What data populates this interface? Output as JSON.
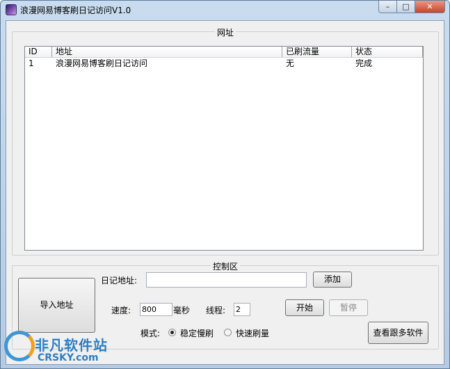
{
  "window": {
    "title": "浪漫网易博客刷日记访问V1.0",
    "controls": {
      "minimize": "–",
      "maximize": "□",
      "close": "✕"
    }
  },
  "url_group": {
    "title": "网址",
    "columns": [
      "ID",
      "地址",
      "已刷流量",
      "状态"
    ],
    "rows": [
      {
        "id": "1",
        "address": "浪漫网易博客刷日记访问",
        "traffic": "无",
        "status": "完成"
      }
    ]
  },
  "control_group": {
    "title": "控制区",
    "import_button": "导入地址",
    "diary_address_label": "日记地址:",
    "diary_address_value": "",
    "add_button": "添加",
    "speed_label": "速度:",
    "speed_value": "800",
    "speed_unit": "毫秒",
    "threads_label": "线程:",
    "threads_value": "2",
    "start_button": "开始",
    "pause_button": "暂停",
    "mode_label": "模式:",
    "mode_options": [
      "稳定慢刷",
      "快速刷量"
    ],
    "mode_selected": "稳定慢刷",
    "more_software_button": "查看跟多软件"
  },
  "watermark": {
    "cn": "非凡软件站",
    "en": "CRSKY.com"
  },
  "colors": {
    "title_bar": "#c9dcef",
    "client_bg": "#f0f0f0",
    "close_button": "#c6452d",
    "watermark": "#2c7fc4"
  }
}
